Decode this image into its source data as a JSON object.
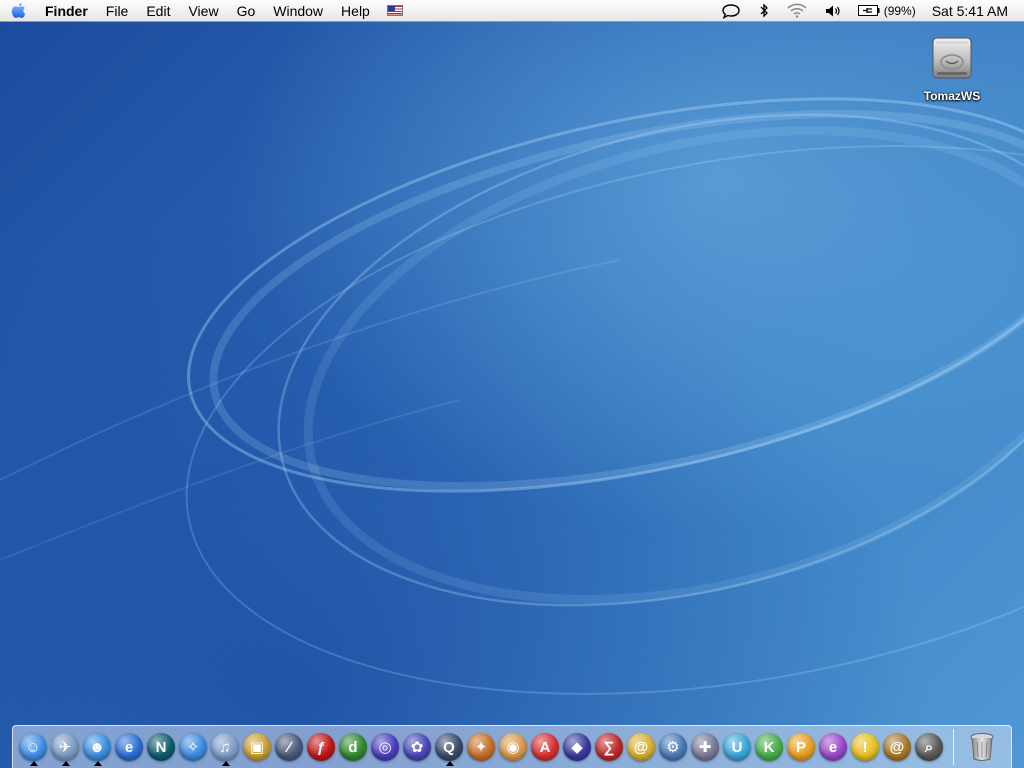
{
  "menubar": {
    "apple_icon": "apple-icon",
    "app_name": "Finder",
    "menus": [
      "File",
      "Edit",
      "View",
      "Go",
      "Window",
      "Help"
    ],
    "input_menu_icon": "us-flag-icon",
    "status_icons": [
      "ichat-status-icon",
      "bluetooth-icon",
      "wifi-icon",
      "volume-icon"
    ],
    "battery_text": "(99%)",
    "clock": "Sat 5:41 AM"
  },
  "desktop": {
    "icons": [
      {
        "label": "TomazWS",
        "icon": "hard-drive-icon"
      }
    ]
  },
  "dock": {
    "apps": [
      {
        "name": "finder",
        "glyph": "☺",
        "color": "#3d8ee6",
        "running": true
      },
      {
        "name": "mail",
        "glyph": "✈",
        "color": "#7a9bbf",
        "running": true
      },
      {
        "name": "ichat",
        "glyph": "☻",
        "color": "#3b8fe0",
        "running": true
      },
      {
        "name": "internet-explorer",
        "glyph": "e",
        "color": "#2a6fd6",
        "running": false
      },
      {
        "name": "netscape",
        "glyph": "N",
        "color": "#0f5c6e",
        "running": false
      },
      {
        "name": "safari",
        "glyph": "✧",
        "color": "#3a8be0",
        "running": false
      },
      {
        "name": "itunes",
        "glyph": "♫",
        "color": "#7f9ec8",
        "running": true
      },
      {
        "name": "transmit",
        "glyph": "▣",
        "color": "#c9a030",
        "running": false
      },
      {
        "name": "pen-tool",
        "glyph": "∕",
        "color": "#4a5a7a",
        "running": false
      },
      {
        "name": "flash",
        "glyph": "ƒ",
        "color": "#c01818",
        "running": false
      },
      {
        "name": "dreamweaver",
        "glyph": "d",
        "color": "#2f8a2f",
        "running": false
      },
      {
        "name": "fireworks",
        "glyph": "◎",
        "color": "#4a3fbf",
        "running": false
      },
      {
        "name": "freehand",
        "glyph": "✿",
        "color": "#4848b8",
        "running": false
      },
      {
        "name": "quicktime",
        "glyph": "Q",
        "color": "#3a4a6a",
        "running": true
      },
      {
        "name": "illustrator",
        "glyph": "✦",
        "color": "#c8702a",
        "running": false
      },
      {
        "name": "preview",
        "glyph": "◉",
        "color": "#d89a4a",
        "running": false
      },
      {
        "name": "acrobat",
        "glyph": "A",
        "color": "#d83030",
        "running": false
      },
      {
        "name": "stuffit",
        "glyph": "◆",
        "color": "#3a3aa0",
        "running": false
      },
      {
        "name": "mathtype",
        "glyph": "∑",
        "color": "#c02828",
        "running": false
      },
      {
        "name": "fetch",
        "glyph": "@",
        "color": "#d8b030",
        "running": false
      },
      {
        "name": "system-preferences",
        "glyph": "⚙",
        "color": "#4a7ab8",
        "running": false
      },
      {
        "name": "disk-utility",
        "glyph": "✚",
        "color": "#7a7a9a",
        "running": false
      },
      {
        "name": "app-u",
        "glyph": "U",
        "color": "#3aa8d8",
        "running": false
      },
      {
        "name": "app-k",
        "glyph": "K",
        "color": "#48b048",
        "running": false
      },
      {
        "name": "app-p",
        "glyph": "P",
        "color": "#e8a020",
        "running": false
      },
      {
        "name": "app-e",
        "glyph": "e",
        "color": "#9a48c8",
        "running": false
      },
      {
        "name": "console",
        "glyph": "!",
        "color": "#e8c020",
        "running": false
      },
      {
        "name": "address-book",
        "glyph": "@",
        "color": "#a8782a",
        "running": false
      },
      {
        "name": "sherlock",
        "glyph": "⌕",
        "color": "#5a5a5a",
        "running": false
      }
    ],
    "trash_icon": "trash-icon"
  }
}
